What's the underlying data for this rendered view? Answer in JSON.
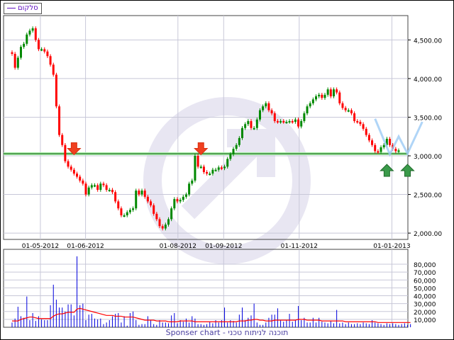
{
  "legend": {
    "label": "סלקום",
    "color": "#6010c0"
  },
  "footer": "Sponser chart - תוכנה לניתוח טכני",
  "colors": {
    "up": "#008800",
    "down": "#ff0000",
    "grid": "#c8c8d8",
    "support": "#005000",
    "volume": "#0000dd",
    "volume_ma": "#ff0000",
    "pattern": "#9ccaf5",
    "watermark": "#e8e6f2"
  },
  "chart_data": [
    {
      "type": "candlestick",
      "title": "סלקום",
      "ylim": [
        1960,
        4830
      ],
      "yticks": [
        2000,
        2500,
        3000,
        3500,
        4000,
        4500
      ],
      "ytick_labels": [
        "2,000.00",
        "2,500.00",
        "3,000.00",
        "3,500.00",
        "4,000.00",
        "4,500.00"
      ],
      "xticks": [
        {
          "label": "01-05-2012",
          "index": 9.6
        },
        {
          "label": "01-06-2012",
          "index": 24.9
        },
        {
          "label": "01-08-2012",
          "index": 56.2
        },
        {
          "label": "01-09-2012",
          "index": 71.7
        },
        {
          "label": "01-11-2012",
          "index": 97.3
        },
        {
          "label": "01-01-2013",
          "index": 128.7
        }
      ],
      "close": [
        4320,
        4140,
        4270,
        4410,
        4450,
        4570,
        4620,
        4650,
        4500,
        4380,
        4380,
        4350,
        4290,
        4180,
        4050,
        3640,
        3270,
        3140,
        2930,
        2860,
        2820,
        2770,
        2730,
        2680,
        2640,
        2500,
        2590,
        2620,
        2620,
        2560,
        2640,
        2620,
        2560,
        2560,
        2530,
        2410,
        2320,
        2230,
        2230,
        2270,
        2300,
        2320,
        2550,
        2500,
        2550,
        2470,
        2410,
        2360,
        2250,
        2180,
        2090,
        2060,
        2110,
        2180,
        2320,
        2440,
        2410,
        2430,
        2470,
        2500,
        2640,
        2680,
        3000,
        2860,
        2860,
        2790,
        2770,
        2770,
        2820,
        2820,
        2850,
        2840,
        2860,
        2960,
        3020,
        3090,
        3140,
        3230,
        3360,
        3410,
        3450,
        3360,
        3360,
        3470,
        3590,
        3640,
        3680,
        3590,
        3550,
        3450,
        3440,
        3450,
        3440,
        3440,
        3450,
        3440,
        3470,
        3380,
        3450,
        3550,
        3640,
        3680,
        3730,
        3770,
        3790,
        3750,
        3790,
        3860,
        3770,
        3860,
        3820,
        3680,
        3620,
        3590,
        3590,
        3550,
        3450,
        3440,
        3410,
        3350,
        3270,
        3200,
        3140,
        3060,
        3050,
        3110,
        3140,
        3220,
        3140,
        3090,
        3060,
        3070
      ],
      "support_level": 3027,
      "sell_signals": [
        {
          "index": 21,
          "price": 3170
        },
        {
          "index": 64,
          "price": 3170
        }
      ],
      "buy_signals": [
        {
          "index": 127,
          "price": 2890
        },
        {
          "index": 134,
          "price": 2890
        }
      ],
      "pattern_line": [
        {
          "index": 123,
          "price": 3480
        },
        {
          "index": 128,
          "price": 3020
        },
        {
          "index": 131,
          "price": 3250
        },
        {
          "index": 134,
          "price": 3030
        },
        {
          "index": 139,
          "price": 3440
        }
      ]
    },
    {
      "type": "bar",
      "title": "Volume",
      "ylim": [
        0,
        90000
      ],
      "yticks": [
        10000,
        20000,
        30000,
        40000,
        50000,
        60000,
        70000,
        80000
      ],
      "ytick_labels": [
        "10,000",
        "20,000",
        "30,000",
        "40,000",
        "50,000",
        "60,000",
        "70,000",
        "80,000"
      ],
      "values": [
        6000,
        11000,
        26000,
        14000,
        12000,
        39000,
        9000,
        18000,
        8000,
        14000,
        10000,
        9000,
        9000,
        28000,
        54000,
        35000,
        25000,
        25000,
        20000,
        29000,
        29000,
        15000,
        90000,
        28000,
        30000,
        9000,
        16000,
        17000,
        11000,
        10000,
        11000,
        4000,
        6000,
        9000,
        14000,
        17000,
        18000,
        6000,
        14000,
        2000,
        18000,
        20000,
        9000,
        3000,
        4000,
        4000,
        14000,
        9000,
        4000,
        3000,
        9000,
        6000,
        6000,
        5000,
        15000,
        18000,
        5000,
        9000,
        7000,
        11000,
        6000,
        14000,
        11000,
        4000,
        4000,
        3000,
        4000,
        7000,
        5000,
        9000,
        6000,
        9000,
        25000,
        6000,
        9000,
        8000,
        6000,
        16000,
        25000,
        9000,
        12000,
        15000,
        30000,
        6000,
        3000,
        3000,
        6000,
        12000,
        16000,
        16000,
        24000,
        9000,
        7000,
        9000,
        17000,
        7000,
        9000,
        27000,
        9000,
        12000,
        6000,
        6000,
        12000,
        6000,
        12000,
        7000,
        6000,
        5000,
        8000,
        5000,
        22000,
        5000,
        6000,
        4000,
        6000,
        4000,
        4000,
        5000,
        4000,
        6000,
        5000,
        4000,
        9000,
        6000,
        5000,
        4000,
        3000,
        5000,
        4000,
        5000,
        4000,
        3000,
        4000,
        5000,
        3000,
        4000
      ],
      "moving_average": [
        8000,
        8000,
        8000,
        10000,
        11000,
        12000,
        13000,
        13000,
        12000,
        11000,
        11000,
        11000,
        11000,
        11000,
        14000,
        16000,
        17000,
        17000,
        18000,
        19000,
        19000,
        19000,
        23000,
        24000,
        23000,
        22000,
        21000,
        20000,
        19000,
        18000,
        17000,
        16000,
        15000,
        15000,
        15000,
        14000,
        14000,
        14000,
        13000,
        13000,
        13000,
        13000,
        12000,
        11000,
        10000,
        9000,
        9000,
        9000,
        9000,
        8000,
        8000,
        8000,
        8000,
        7000,
        7000,
        7000,
        7000,
        8000,
        8000,
        8000,
        8000,
        8000,
        7000,
        7000,
        7000,
        7000,
        7000,
        7000,
        7000,
        7000,
        7000,
        7000,
        7000,
        7000,
        7000,
        7000,
        7000,
        8000,
        8000,
        8000,
        9000,
        9000,
        10000,
        10000,
        9000,
        9000,
        8000,
        8000,
        8000,
        9000,
        9000,
        9000,
        9000,
        9000,
        9000,
        9000,
        9000,
        10000,
        10000,
        10000,
        9000,
        9000,
        9000,
        9000,
        9000,
        8000,
        8000,
        8000,
        8000,
        8000,
        8000,
        8000,
        8000,
        7000,
        7000,
        7000,
        7000,
        7000,
        7000,
        7000,
        7000,
        7000,
        7000,
        7000,
        6000,
        6000,
        6000,
        6000,
        6000,
        6000,
        6000,
        6000,
        6000,
        6000,
        6000,
        6000
      ]
    }
  ]
}
